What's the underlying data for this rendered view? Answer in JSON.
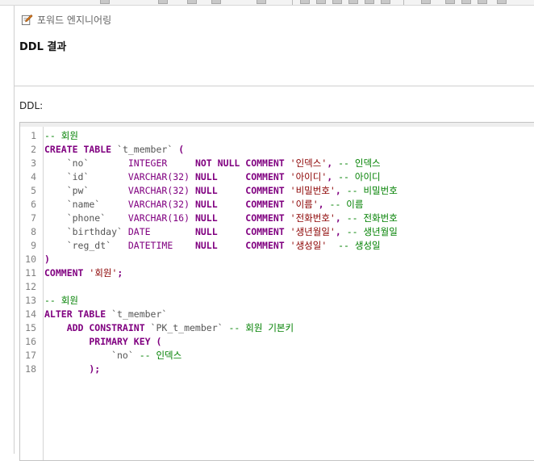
{
  "panel": {
    "title": "포워드 엔지니어링",
    "section_title": "DDL 결과",
    "ddl_label": "DDL:"
  },
  "colors": {
    "keyword": "#800080",
    "string": "#8b0000",
    "comment": "#008000",
    "line_number": "#808080"
  },
  "icons": [
    "edit-icon"
  ],
  "code": {
    "lines": [
      {
        "num": "1",
        "tokens": [
          {
            "t": "-- 회원",
            "c": "cm"
          }
        ]
      },
      {
        "num": "2",
        "tokens": [
          {
            "t": "CREATE TABLE",
            "c": "kw"
          },
          {
            "t": " `t_member` ",
            "c": "tick"
          },
          {
            "t": "(",
            "c": "kw"
          }
        ]
      },
      {
        "num": "3",
        "tokens": [
          {
            "t": "    `no`       ",
            "c": "tick"
          },
          {
            "t": "INTEGER     ",
            "c": "dt"
          },
          {
            "t": "NOT NULL ",
            "c": "kw"
          },
          {
            "t": "COMMENT ",
            "c": "kw"
          },
          {
            "t": "'인덱스'",
            "c": "str"
          },
          {
            "t": ", ",
            "c": "kw"
          },
          {
            "t": "-- 인덱스",
            "c": "cm"
          }
        ]
      },
      {
        "num": "4",
        "tokens": [
          {
            "t": "    `id`       ",
            "c": "tick"
          },
          {
            "t": "VARCHAR(32) ",
            "c": "dt"
          },
          {
            "t": "NULL     ",
            "c": "kw"
          },
          {
            "t": "COMMENT ",
            "c": "kw"
          },
          {
            "t": "'아이디'",
            "c": "str"
          },
          {
            "t": ", ",
            "c": "kw"
          },
          {
            "t": "-- 아이디",
            "c": "cm"
          }
        ]
      },
      {
        "num": "5",
        "tokens": [
          {
            "t": "    `pw`       ",
            "c": "tick"
          },
          {
            "t": "VARCHAR(32) ",
            "c": "dt"
          },
          {
            "t": "NULL     ",
            "c": "kw"
          },
          {
            "t": "COMMENT ",
            "c": "kw"
          },
          {
            "t": "'비밀번호'",
            "c": "str"
          },
          {
            "t": ", ",
            "c": "kw"
          },
          {
            "t": "-- 비밀번호",
            "c": "cm"
          }
        ]
      },
      {
        "num": "6",
        "tokens": [
          {
            "t": "    `name`     ",
            "c": "tick"
          },
          {
            "t": "VARCHAR(32) ",
            "c": "dt"
          },
          {
            "t": "NULL     ",
            "c": "kw"
          },
          {
            "t": "COMMENT ",
            "c": "kw"
          },
          {
            "t": "'이름'",
            "c": "str"
          },
          {
            "t": ", ",
            "c": "kw"
          },
          {
            "t": "-- 이름",
            "c": "cm"
          }
        ]
      },
      {
        "num": "7",
        "tokens": [
          {
            "t": "    `phone`    ",
            "c": "tick"
          },
          {
            "t": "VARCHAR(16) ",
            "c": "dt"
          },
          {
            "t": "NULL     ",
            "c": "kw"
          },
          {
            "t": "COMMENT ",
            "c": "kw"
          },
          {
            "t": "'전화번호'",
            "c": "str"
          },
          {
            "t": ", ",
            "c": "kw"
          },
          {
            "t": "-- 전화번호",
            "c": "cm"
          }
        ]
      },
      {
        "num": "8",
        "tokens": [
          {
            "t": "    `birthday` ",
            "c": "tick"
          },
          {
            "t": "DATE        ",
            "c": "dt"
          },
          {
            "t": "NULL     ",
            "c": "kw"
          },
          {
            "t": "COMMENT ",
            "c": "kw"
          },
          {
            "t": "'생년월일'",
            "c": "str"
          },
          {
            "t": ", ",
            "c": "kw"
          },
          {
            "t": "-- 생년월일",
            "c": "cm"
          }
        ]
      },
      {
        "num": "9",
        "tokens": [
          {
            "t": "    `reg_dt`   ",
            "c": "tick"
          },
          {
            "t": "DATETIME    ",
            "c": "dt"
          },
          {
            "t": "NULL     ",
            "c": "kw"
          },
          {
            "t": "COMMENT ",
            "c": "kw"
          },
          {
            "t": "'생성일'",
            "c": "str"
          },
          {
            "t": "  ",
            "c": "kw"
          },
          {
            "t": "-- 생성일",
            "c": "cm"
          }
        ]
      },
      {
        "num": "10",
        "tokens": [
          {
            "t": ")",
            "c": "kw"
          }
        ]
      },
      {
        "num": "11",
        "tokens": [
          {
            "t": "COMMENT ",
            "c": "kw"
          },
          {
            "t": "'회원'",
            "c": "str"
          },
          {
            "t": ";",
            "c": "kw"
          }
        ]
      },
      {
        "num": "12",
        "tokens": []
      },
      {
        "num": "13",
        "tokens": [
          {
            "t": "-- 회원",
            "c": "cm"
          }
        ]
      },
      {
        "num": "14",
        "tokens": [
          {
            "t": "ALTER TABLE",
            "c": "kw"
          },
          {
            "t": " `t_member`",
            "c": "tick"
          }
        ]
      },
      {
        "num": "15",
        "tokens": [
          {
            "t": "    ADD CONSTRAINT",
            "c": "kw"
          },
          {
            "t": " `PK_t_member` ",
            "c": "tick"
          },
          {
            "t": "-- 회원 기본키",
            "c": "cm"
          }
        ]
      },
      {
        "num": "16",
        "tokens": [
          {
            "t": "        PRIMARY KEY (",
            "c": "kw"
          }
        ]
      },
      {
        "num": "17",
        "tokens": [
          {
            "t": "            `no` ",
            "c": "tick"
          },
          {
            "t": "-- 인덱스",
            "c": "cm"
          }
        ]
      },
      {
        "num": "18",
        "tokens": [
          {
            "t": "        );",
            "c": "kw"
          }
        ]
      }
    ]
  }
}
